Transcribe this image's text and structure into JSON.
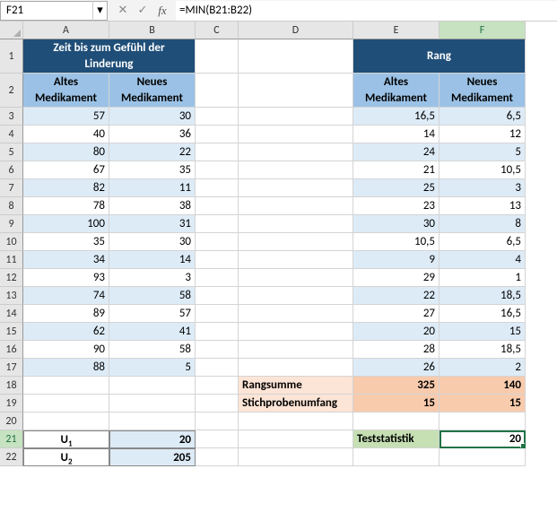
{
  "namebox": "F21",
  "formula": "=MIN(B21:B22)",
  "cols": [
    "A",
    "B",
    "C",
    "D",
    "E",
    "F"
  ],
  "activeCol": "F",
  "activeRow": 21,
  "title1": "Zeit bis zum Gefühl der Linderung",
  "title2": "Rang",
  "hdrA": "Altes Medikament",
  "hdrB": "Neues Medikament",
  "hdrE": "Altes Medikament",
  "hdrF": "Neues Medikament",
  "rows": [
    {
      "r": 3,
      "a": "57",
      "b": "30",
      "e": "16,5",
      "f": "6,5"
    },
    {
      "r": 4,
      "a": "40",
      "b": "36",
      "e": "14",
      "f": "12"
    },
    {
      "r": 5,
      "a": "80",
      "b": "22",
      "e": "24",
      "f": "5"
    },
    {
      "r": 6,
      "a": "67",
      "b": "35",
      "e": "21",
      "f": "10,5"
    },
    {
      "r": 7,
      "a": "82",
      "b": "11",
      "e": "25",
      "f": "3"
    },
    {
      "r": 8,
      "a": "78",
      "b": "38",
      "e": "23",
      "f": "13"
    },
    {
      "r": 9,
      "a": "100",
      "b": "31",
      "e": "30",
      "f": "8"
    },
    {
      "r": 10,
      "a": "35",
      "b": "30",
      "e": "10,5",
      "f": "6,5"
    },
    {
      "r": 11,
      "a": "34",
      "b": "14",
      "e": "9",
      "f": "4"
    },
    {
      "r": 12,
      "a": "93",
      "b": "3",
      "e": "29",
      "f": "1"
    },
    {
      "r": 13,
      "a": "74",
      "b": "58",
      "e": "22",
      "f": "18,5"
    },
    {
      "r": 14,
      "a": "89",
      "b": "57",
      "e": "27",
      "f": "16,5"
    },
    {
      "r": 15,
      "a": "62",
      "b": "41",
      "e": "20",
      "f": "15"
    },
    {
      "r": 16,
      "a": "90",
      "b": "58",
      "e": "28",
      "f": "18,5"
    },
    {
      "r": 17,
      "a": "88",
      "b": "5",
      "e": "26",
      "f": "2"
    }
  ],
  "rangsummeLabel": "Rangsumme",
  "rangsummeE": "325",
  "rangsummeF": "140",
  "stichLabel": "Stichprobenumfang",
  "stichE": "15",
  "stichF": "15",
  "u1Label": "U",
  "u1Sub": "1",
  "u1Val": "20",
  "u2Label": "U",
  "u2Sub": "2",
  "u2Val": "205",
  "teststatLabel": "Teststatistik",
  "teststatVal": "20"
}
